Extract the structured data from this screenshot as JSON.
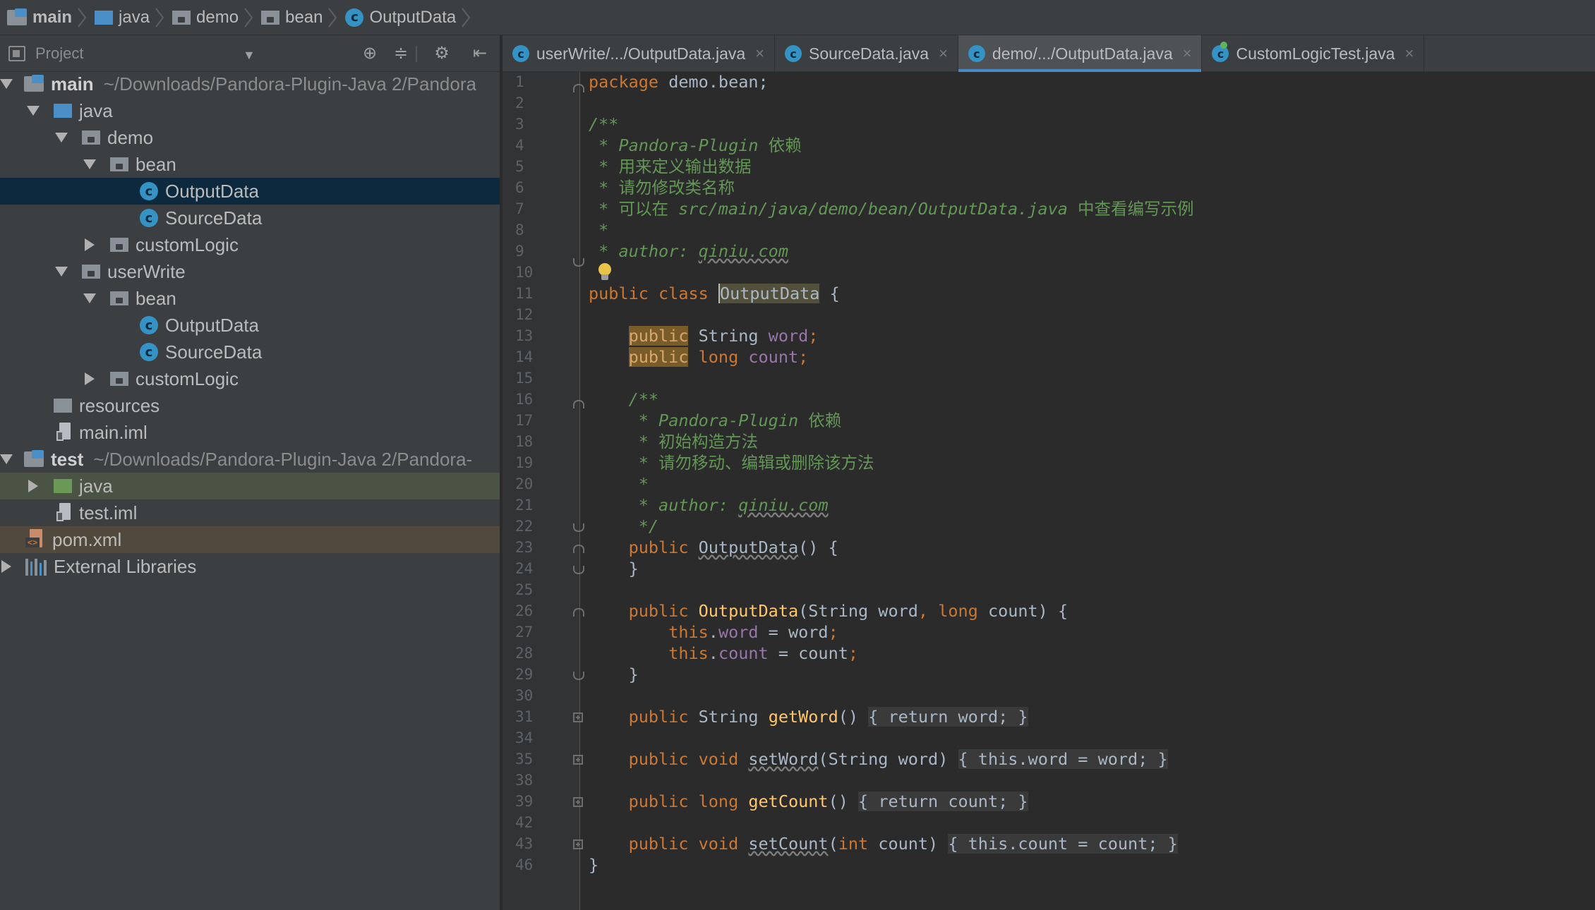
{
  "breadcrumb": [
    {
      "label": "main",
      "icon": "module-icon"
    },
    {
      "label": "java",
      "icon": "folder-icon"
    },
    {
      "label": "demo",
      "icon": "package-icon"
    },
    {
      "label": "bean",
      "icon": "package-icon"
    },
    {
      "label": "OutputData",
      "icon": "class-icon"
    }
  ],
  "project": {
    "title": "Project",
    "tree": [
      {
        "label": "main",
        "path": "~/Downloads/Pandora-Plugin-Java 2/Pandora",
        "icon": "module-icon",
        "arrow": "down",
        "bold": true
      },
      {
        "label": "java",
        "icon": "folder-icon",
        "arrow": "down"
      },
      {
        "label": "demo",
        "icon": "package-icon",
        "arrow": "down"
      },
      {
        "label": "bean",
        "icon": "package-icon",
        "arrow": "down"
      },
      {
        "label": "OutputData",
        "icon": "class-icon",
        "selected": true
      },
      {
        "label": "SourceData",
        "icon": "class-icon"
      },
      {
        "label": "customLogic",
        "icon": "package-icon",
        "arrow": "right"
      },
      {
        "label": "userWrite",
        "icon": "package-icon",
        "arrow": "down"
      },
      {
        "label": "bean",
        "icon": "package-icon",
        "arrow": "down"
      },
      {
        "label": "OutputData",
        "icon": "class-icon"
      },
      {
        "label": "SourceData",
        "icon": "class-icon"
      },
      {
        "label": "customLogic",
        "icon": "package-icon",
        "arrow": "right"
      },
      {
        "label": "resources",
        "icon": "folder-icon"
      },
      {
        "label": "main.iml",
        "icon": "iml-file-icon"
      },
      {
        "label": "test",
        "path": "~/Downloads/Pandora-Plugin-Java 2/Pandora-",
        "icon": "module-icon",
        "arrow": "down",
        "bold": true
      },
      {
        "label": "java",
        "icon": "test-folder-icon",
        "arrow": "right"
      },
      {
        "label": "test.iml",
        "icon": "iml-file-icon"
      },
      {
        "label": "pom.xml",
        "icon": "maven-xml-icon"
      },
      {
        "label": "External Libraries",
        "icon": "library-icon",
        "arrow": "right"
      }
    ]
  },
  "tabs": [
    {
      "label": "userWrite/.../OutputData.java",
      "active": false
    },
    {
      "label": "SourceData.java",
      "active": false
    },
    {
      "label": "demo/.../OutputData.java",
      "active": true
    },
    {
      "label": "CustomLogicTest.java",
      "active": false
    }
  ],
  "editor": {
    "line_numbers": [
      "1",
      "2",
      "3",
      "4",
      "5",
      "6",
      "7",
      "8",
      "9",
      "10",
      "11",
      "12",
      "13",
      "14",
      "15",
      "16",
      "17",
      "18",
      "19",
      "20",
      "21",
      "22",
      "23",
      "24",
      "25",
      "26",
      "27",
      "28",
      "29",
      "30",
      "31",
      "34",
      "35",
      "38",
      "39",
      "42",
      "43",
      "46"
    ],
    "code": {
      "l1_kw": "package",
      "l1_rest": " demo.bean;",
      "l3": "/**",
      "l4_a": " * ",
      "l4_b": "Pandora-Plugin",
      "l4_c": " 依赖",
      "l5": " * 用来定义输出数据",
      "l6": " * 请勿修改类名称",
      "l7_a": " * 可以在 ",
      "l7_b": "src/main/java/demo/bean/OutputData.java",
      "l7_c": " 中查看编写示例",
      "l8": " *",
      "l9_a": " * ",
      "l9_b": "author: ",
      "l9_c": "qiniu.com",
      "l10": " */",
      "l11_a": "public class ",
      "l11_b": "OutputData",
      "l11_c": " {",
      "l13_kw": "public",
      "l13_type": " String ",
      "l13_field": "word",
      "l13_end": ";",
      "l14_kw": "public",
      "l14_type": " long ",
      "l14_field": "count",
      "l14_end": ";",
      "l16": "/**",
      "l17_a": " * ",
      "l17_b": "Pandora-Plugin",
      "l17_c": " 依赖",
      "l18": " * 初始构造方法",
      "l19": " * 请勿移动、编辑或删除该方法",
      "l20": " *",
      "l21_a": " * ",
      "l21_b": "author: ",
      "l21_c": "qiniu.com",
      "l22": " */",
      "l23_kw": "public ",
      "l23_name": "OutputData",
      "l23_end": "() {",
      "l24": "}",
      "l26_kw": "public ",
      "l26_name": "OutputData",
      "l26_p1": "(String word",
      "l26_comma": ", ",
      "l26_kw2": "long",
      "l26_p2": " count) {",
      "l27_this": "this",
      "l27_dot": ".",
      "l27_field": "word",
      "l27_rest": " = word",
      "l27_semi": ";",
      "l28_this": "this",
      "l28_dot": ".",
      "l28_field": "count",
      "l28_rest": " = count",
      "l28_semi": ";",
      "l29": "}",
      "l31_kw": "public ",
      "l31_type": "String ",
      "l31_name": "getWord",
      "l31_par": "() ",
      "l31_open": "{ ",
      "l31_ret": "return ",
      "l31_field": "word",
      "l31_semi": ";",
      "l31_close": " }",
      "l35_kw": "public void ",
      "l35_name": "setWord",
      "l35_par": "(String word) ",
      "l35_open": "{ ",
      "l35_this": "this",
      "l35_dot": ".",
      "l35_field": "word",
      "l35_rest": " = word",
      "l35_semi": ";",
      "l35_close": " }",
      "l39_kw": "public long ",
      "l39_name": "getCount",
      "l39_par": "() ",
      "l39_open": "{ ",
      "l39_ret": "return ",
      "l39_field": "count",
      "l39_semi": ";",
      "l39_close": " }",
      "l43_kw": "public void ",
      "l43_name": "setCount",
      "l43_par1": "(",
      "l43_kw2": "int",
      "l43_par2": " count) ",
      "l43_open": "{ ",
      "l43_this": "this",
      "l43_dot": ".",
      "l43_field": "count",
      "l43_rest": " = count",
      "l43_semi": ";",
      "l43_close": " }",
      "l46": "}"
    }
  },
  "colors": {
    "keyword": "#cc7832",
    "field": "#9876aa",
    "method": "#ffc66d",
    "doc_comment": "#629755",
    "selection": "#0d293e",
    "active_tab_underline": "#4a88c7"
  }
}
